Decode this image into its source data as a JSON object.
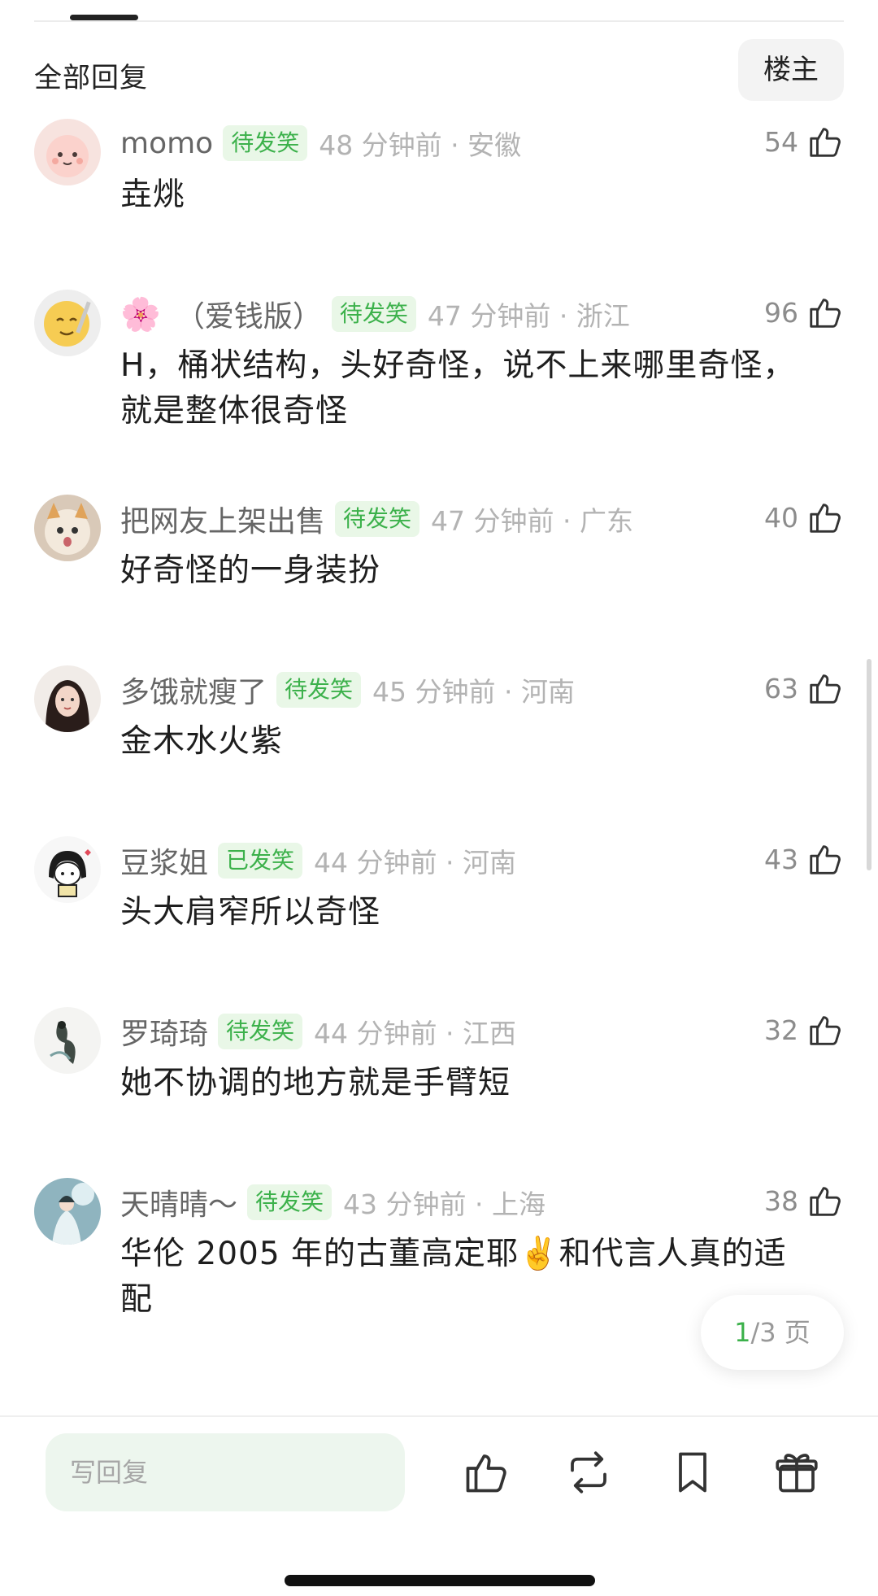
{
  "header": {
    "title": "全部回复",
    "owner_button": "楼主"
  },
  "comments": [
    {
      "username": "momo",
      "badge": "待发笑",
      "time_location": "48 分钟前 · 安徽",
      "likes": "54",
      "text": "垚烑"
    },
    {
      "username": "（爱钱版）",
      "username_emoji": "🌸",
      "badge": "待发笑",
      "time_location": "47 分钟前 · 浙江",
      "likes": "96",
      "text": "H，桶状结构，头好奇怪，说不上来哪里奇怪，就是整体很奇怪"
    },
    {
      "username": "把网友上架出售",
      "badge": "待发笑",
      "time_location": "47 分钟前 · 广东",
      "likes": "40",
      "text": "好奇怪的一身装扮"
    },
    {
      "username": "多饿就瘦了",
      "badge": "待发笑",
      "time_location": "45 分钟前 · 河南",
      "likes": "63",
      "text": "金木水火紫"
    },
    {
      "username": "豆浆姐",
      "badge": "已发笑",
      "time_location": "44 分钟前 · 河南",
      "likes": "43",
      "text": "头大肩窄所以奇怪"
    },
    {
      "username": "罗琦琦",
      "badge": "待发笑",
      "time_location": "44 分钟前 · 江西",
      "likes": "32",
      "text": "她不协调的地方就是手臂短"
    },
    {
      "username": "天晴晴～",
      "badge": "待发笑",
      "time_location": "43 分钟前 · 上海",
      "likes": "38",
      "text": "华伦 2005 年的古董高定耶✌️和代言人真的适配"
    }
  ],
  "pagination": {
    "current": "1",
    "rest": "/3 页"
  },
  "bottom_bar": {
    "reply_placeholder": "写回复"
  },
  "icons": {
    "like": "thumbs-up-icon",
    "repost": "repost-icon",
    "bookmark": "bookmark-icon",
    "gift": "gift-icon"
  },
  "colors": {
    "accent_green": "#3cb14b",
    "badge_bg": "#e9f7e7",
    "meta_gray": "#b3b3b3"
  }
}
